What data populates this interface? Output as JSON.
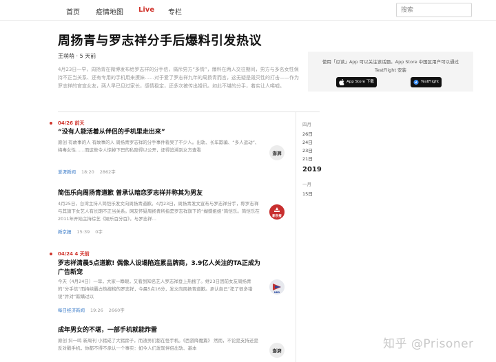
{
  "nav": {
    "items": [
      "首页",
      "疫情地图",
      "Live",
      "专栏"
    ],
    "search_placeholder": "搜索",
    "live_color": "#d0342c"
  },
  "article": {
    "title": "周扬青与罗志祥分手后爆料引发热议",
    "author": "王萌萌",
    "time_ago": "5 天前",
    "intro": "4月23日一早，周扬青在微博发布给罗志祥的分手信，痛斥男方“多情”，爆料在两人交往期间，男方与多名女性保持不正当关系、还有专用的手机用来撩妹……对于爱了罗志祥九年的周扬青而言，这无疑是毁灭性的打击——作为罗志祥的官宣女友，两人早已见过家长，感情稳定，还多次被传出婚讯。如此不堪的分手，着实让人唏嘘。"
  },
  "sidebar": {
    "text": "使用「瓜读」App 可以关注该话题。App Store 中国区用户可以通过 TestFlight 安装",
    "app_store_label": "App Store 下载",
    "testflight_label": "TestFlight"
  },
  "timeline": {
    "month_label": "四月",
    "days": [
      "26日",
      "24日",
      "23日",
      "21日"
    ],
    "year": "2019",
    "month2_label": "一月",
    "days2": [
      "15日"
    ]
  },
  "groups": [
    {
      "date": "04/26",
      "relative": "前天",
      "items": [
        {
          "title": "“没有人能活着从伴侣的手机里走出来”",
          "snippet": "原创 有故事的人 有故事的人 周扬青罗志祥的分手事件看哭了不少人。出轨、长年欺骗、“多人运动”、梅毒女性……而这些令人惊掉下巴的私隐得以公开，还得追溯到女方查看",
          "source": "澎湃新闻",
          "time": "18:20",
          "words": "2862字",
          "logo_text": "澎湃"
        },
        {
          "title": "简伍乐向周扬青道歉 曾承认暗恋罗志祥并称其为男友",
          "snippet": "4月25日，台湾主持人简恺乐发文向周扬青道歉。4月23日，周扬青发文宣布与罗志祥分手，称罗志祥与其旗下女艺人有长期不正当关系。网友怀疑周扬青所指是罗志祥旗下的“蝴蝶姐姐”简恺乐。简恺乐在2011年开始主持综艺《娱乐百分百》，与罗志祥...",
          "source": "新京报",
          "time": "15:39",
          "words": "0字",
          "logo_text": "新京报"
        }
      ]
    },
    {
      "date": "04/24",
      "relative": "4 天前",
      "items": [
        {
          "title": "罗志祥清晨5点道歉! 偶像人设塌陷连累品牌商，3.9亿人关注的TA正成为广告新宠",
          "snippet": "今天（4月24日）一早，大家一睁眼，又看到知名艺人罗志祥登上热搜了。继23日因前女友周扬青的“分手信”而持续霸占热搜榜的罗志祥，今晨5点16分，发文向周扬青道歉。承认自己“犯了很多错误”并对“欺瞒过以",
          "source": "每日经济新闻",
          "time": "19:26",
          "words": "2660字",
          "logo_text": "NBD"
        },
        {
          "title": "成年男女的不堪，一部手机就能炸雷",
          "snippet": "原创 抖一鸣 新周刊 小猪成了大猪蹄子，而渣男们都在怪手机。《西游降魔篇》 然而，不论是支持还是反对戳手机，你都不得不承认一个事实：如今人们发现伴侣出轨、基本",
          "source": "",
          "time": "",
          "words": "",
          "logo_text": "澎湃"
        }
      ]
    }
  ],
  "watermark": "知乎 @Prisoner"
}
